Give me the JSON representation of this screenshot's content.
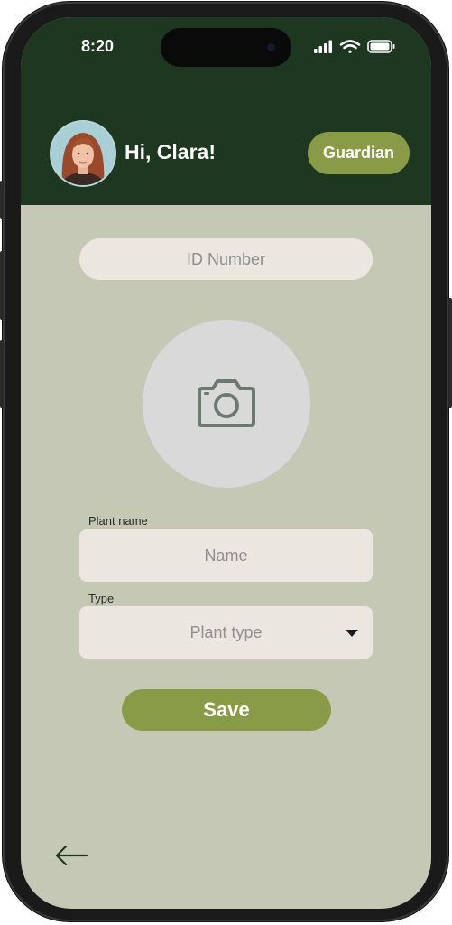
{
  "status_bar": {
    "time": "8:20"
  },
  "header": {
    "greeting": "Hi, Clara!",
    "role_label": "Guardian"
  },
  "form": {
    "id_placeholder": "ID Number",
    "plant_name_label": "Plant name",
    "plant_name_placeholder": "Name",
    "type_label": "Type",
    "type_placeholder": "Plant type",
    "save_label": "Save"
  },
  "icons": {
    "photo": "camera-icon",
    "back": "arrow-left-icon",
    "dropdown": "caret-down-icon",
    "signal": "signal-icon",
    "wifi": "wifi-icon",
    "battery": "battery-icon"
  },
  "colors": {
    "header_bg": "#1d3720",
    "screen_bg": "#c4c8b5",
    "accent": "#8a9b48",
    "field_bg": "#ece6e1"
  }
}
